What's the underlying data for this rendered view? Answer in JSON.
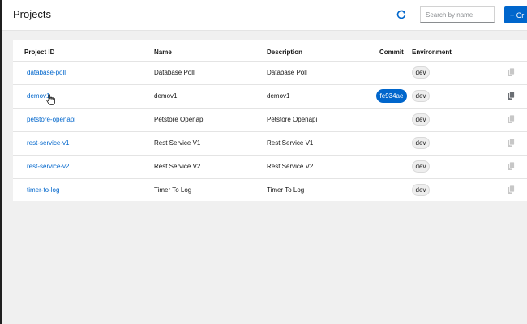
{
  "header": {
    "title": "Projects",
    "refresh_icon": "refresh-icon",
    "search_placeholder": "Search by name",
    "create_label": "+ Cr"
  },
  "table": {
    "columns": {
      "project_id": "Project ID",
      "name": "Name",
      "description": "Description",
      "commit": "Commit",
      "environment": "Environment"
    },
    "rows": [
      {
        "project_id": "database-poll",
        "name": "Database Poll",
        "description": "Database Poll",
        "commit": "",
        "environment": "dev"
      },
      {
        "project_id": "demov1",
        "name": "demov1",
        "description": "demov1",
        "commit": "fe934ae",
        "environment": "dev"
      },
      {
        "project_id": "petstore-openapi",
        "name": "Petstore Openapi",
        "description": "Petstore Openapi",
        "commit": "",
        "environment": "dev"
      },
      {
        "project_id": "rest-service-v1",
        "name": "Rest Service V1",
        "description": "Rest Service V1",
        "commit": "",
        "environment": "dev"
      },
      {
        "project_id": "rest-service-v2",
        "name": "Rest Service V2",
        "description": "Rest Service V2",
        "commit": "",
        "environment": "dev"
      },
      {
        "project_id": "timer-to-log",
        "name": "Timer To Log",
        "description": "Timer To Log",
        "commit": "",
        "environment": "dev"
      }
    ],
    "row_action_icon": "copy-icon"
  },
  "colors": {
    "accent": "#0066cc",
    "page_background": "#f0f0f0",
    "row_action_active": "#6a6e73",
    "row_action_inactive": "#c7c7c7"
  }
}
